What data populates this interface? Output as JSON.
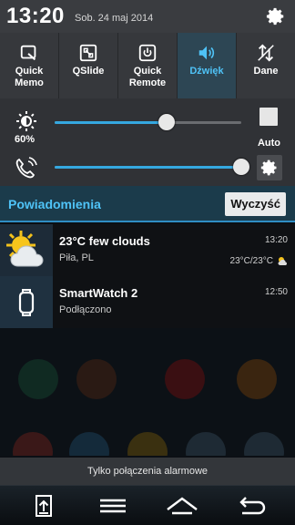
{
  "status_bar": {
    "time": "13:20",
    "date": "Sob. 24 maj 2014",
    "settings_icon": "gear-icon"
  },
  "quick_settings": [
    {
      "label": "Quick Memo",
      "icon": "quick-memo-icon",
      "active": false
    },
    {
      "label": "QSlide",
      "icon": "qslide-icon",
      "active": false
    },
    {
      "label": "Quick Remote",
      "icon": "quick-remote-icon",
      "active": false
    },
    {
      "label": "Dźwięk",
      "icon": "speaker-icon",
      "active": true
    },
    {
      "label": "Dane",
      "icon": "data-arrows-icon",
      "active": false
    }
  ],
  "brightness": {
    "label": "60%",
    "level_percent": 60,
    "auto_label": "Auto",
    "icon": "sun-icon"
  },
  "volume": {
    "level_percent": 100,
    "icon": "phone-ring-icon",
    "settings_icon": "gear-icon"
  },
  "notifications": {
    "title": "Powiadomienia",
    "clear_label": "Wyczyść",
    "items": [
      {
        "title": "23°C  few clouds",
        "subtitle": "Piła, PL",
        "time": "13:20",
        "extra": "23°C/23°C",
        "icon": "weather-sun-cloud-icon"
      },
      {
        "title": "SmartWatch 2",
        "subtitle": "Podłączono",
        "time": "12:50",
        "icon": "smartwatch-icon"
      }
    ]
  },
  "alarm_banner": "Tylko połączenia alarmowe",
  "colors": {
    "accent": "#35a8e0",
    "active_tile": "#2d4654",
    "header_bg": "#1b3b4b"
  }
}
